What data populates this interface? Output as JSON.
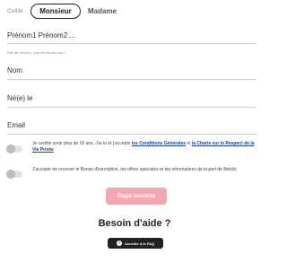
{
  "civility": {
    "label": "Civilité",
    "options": [
      "Monsieur",
      "Madame"
    ],
    "selected": "Monsieur"
  },
  "fields": {
    "prenoms": {
      "placeholder": "Prénom1 Prénom2 ...",
      "hint": "Pas de surnom, pas de pseudo svp !"
    },
    "nom": {
      "label": "Nom"
    },
    "ne_le": {
      "label": "Né(e) le"
    },
    "email": {
      "label": "Email"
    }
  },
  "consents": [
    {
      "text_before": "Je certifie avoir plus de 18 ans. J'ai lu et j'accepte ",
      "link1": "les Conditions Générales",
      "text_mid": " et ",
      "link2": "la Charte sur le Respect de la Vie Privée",
      "checked": false
    },
    {
      "text": "J'accepte de recevoir le Bonus d'inscription, les offres spéciales et les informations de la part de Betclic",
      "checked": false
    }
  ],
  "next_button": {
    "label": "Étape suivante"
  },
  "help": {
    "title": "Besoin d'aide ?",
    "faq_label": "Accéder à la FAQ",
    "faq_icon": "question-circle-icon"
  },
  "colors": {
    "next_button_bg": "#f4a8ae",
    "link": "#1a3d9a",
    "faq_bg": "#222222"
  }
}
